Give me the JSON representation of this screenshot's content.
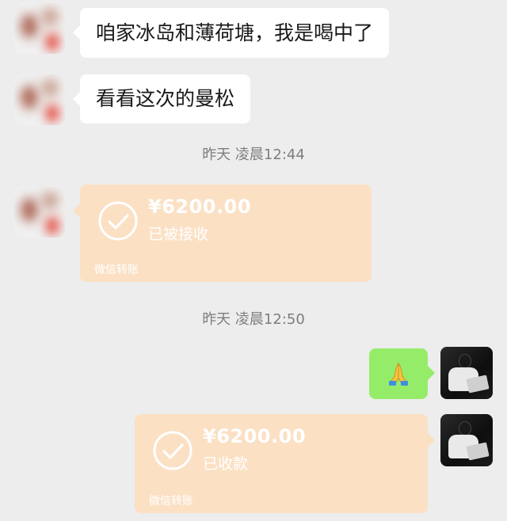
{
  "messages": {
    "msg1": "咱家冰岛和薄荷塘，我是喝中了",
    "msg2": "看看这次的曼松"
  },
  "timestamps": {
    "t1": "昨天 凌晨12:44",
    "t2": "昨天 凌晨12:50"
  },
  "transfer1": {
    "amount": "¥6200.00",
    "status": "已被接收",
    "footer": "微信转账"
  },
  "transfer2": {
    "amount": "¥6200.00",
    "status": "已收款",
    "footer": "微信转账"
  },
  "emoji": {
    "icon": "folded-hands-icon"
  },
  "colors": {
    "background": "#ededed",
    "incoming_bubble": "#ffffff",
    "outgoing_bubble": "#95ec69",
    "transfer_card": "#fbe0c4"
  }
}
